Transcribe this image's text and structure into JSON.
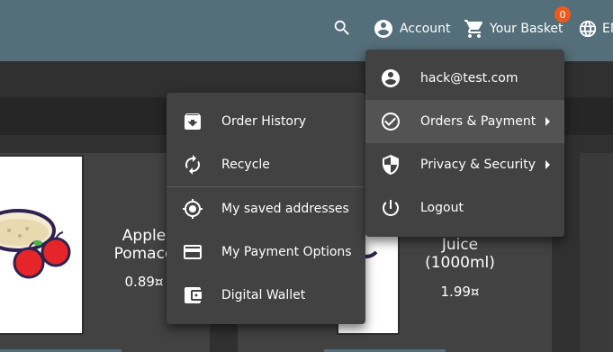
{
  "header": {
    "account_label": "Account",
    "basket_label": "Your Basket",
    "basket_count": "0",
    "language_label": "EN",
    "icons": {
      "search": "search-icon",
      "account": "account-circle-icon",
      "basket": "cart-icon",
      "language": "globe-icon"
    }
  },
  "products": [
    {
      "name": "Apple Pomace",
      "price": "0.89¤"
    },
    {
      "name": "Juice (1000ml)",
      "price": "1.99¤"
    }
  ],
  "account_menu": {
    "items": [
      {
        "label": "hack@test.com",
        "icon": "account-circle-icon"
      },
      {
        "label": "Orders & Payment",
        "icon": "check-circle-icon",
        "has_submenu": true
      },
      {
        "label": "Privacy & Security",
        "icon": "shield-icon",
        "has_submenu": true
      },
      {
        "label": "Logout",
        "icon": "power-icon"
      }
    ]
  },
  "orders_submenu": {
    "items": [
      {
        "label": "Order History",
        "icon": "archive-icon"
      },
      {
        "label": "Recycle",
        "icon": "recycle-icon"
      },
      {
        "label": "My saved addresses",
        "icon": "location-icon"
      },
      {
        "label": "My Payment Options",
        "icon": "credit-card-icon"
      },
      {
        "label": "Digital Wallet",
        "icon": "wallet-icon"
      }
    ]
  },
  "colors": {
    "header": "#546e7a",
    "menu": "#424242",
    "badge": "#ef5a1c",
    "background": "#303030"
  }
}
